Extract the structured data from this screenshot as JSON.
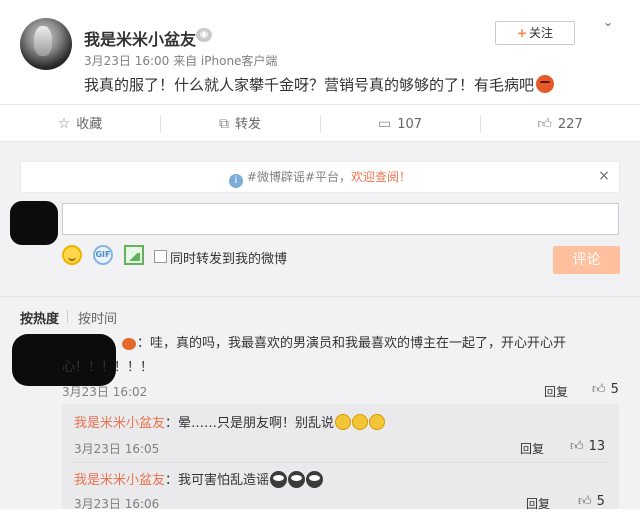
{
  "post": {
    "username": "我是米米小盆友",
    "meta": "3月23日 16:00 来自 iPhone客户端",
    "text": "我真的服了！什么就人家攀千金呀？营销号真的够够的了！有毛病吧",
    "follow_label": "关注",
    "follow_plus": "+"
  },
  "actions": {
    "favorite": "收藏",
    "repost": "转发",
    "comment_count": "107",
    "like_count": "227"
  },
  "notice": {
    "prefix": "#微博辟谣#平台，",
    "link": "欢迎查阅！",
    "close": "×"
  },
  "composer": {
    "input_value": "",
    "checkbox_label": "同时转发到我的微博",
    "submit_label": "评论",
    "gif_label": "GIF"
  },
  "sort": {
    "hot": "按热度",
    "time": "按时间"
  },
  "comments": [
    {
      "text_line1": "：哇，真的吗，我最喜欢的男演员和我最喜欢的博主在一起了，开心开心开",
      "text_line2": "心！！！！！！",
      "time": "3月23日 16:02",
      "reply": "回复",
      "likes": "5"
    }
  ],
  "replies": [
    {
      "name": "我是米米小盆友",
      "text": "：晕……只是朋友啊！别乱说",
      "time": "3月23日 16:05",
      "reply": "回复",
      "likes": "13"
    },
    {
      "name": "我是米米小盆友",
      "text": "：我可害怕乱造谣",
      "time": "3月23日 16:06",
      "reply": "回复",
      "likes": "5"
    }
  ]
}
